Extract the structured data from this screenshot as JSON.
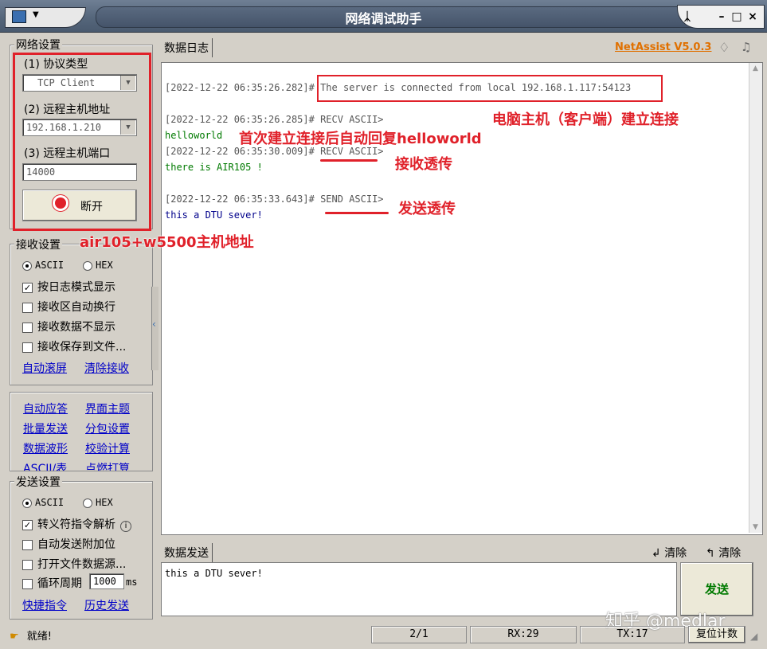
{
  "window": {
    "title": "网络调试助手",
    "menu_icon": "network-icon",
    "pin_label": "ᛣ",
    "min_label": "–",
    "max_label": "□",
    "close_label": "×"
  },
  "network": {
    "group_label": "网络设置",
    "protocol_label": "(1) 协议类型",
    "protocol_value": "TCP Client",
    "host_label": "(2) 远程主机地址",
    "host_value": "192.168.1.210",
    "port_label": "(3) 远程主机端口",
    "port_value": "14000",
    "disconnect_label": "断开"
  },
  "receive": {
    "group_label": "接收设置",
    "ascii_label": "ASCII",
    "hex_label": "HEX",
    "options": [
      {
        "label": "按日志模式显示",
        "checked": true
      },
      {
        "label": "接收区自动换行",
        "checked": false
      },
      {
        "label": "接收数据不显示",
        "checked": false
      },
      {
        "label": "接收保存到文件...",
        "checked": false
      }
    ],
    "link_autoscroll": "自动滚屏",
    "link_clear": "清除接收"
  },
  "tools": {
    "links": [
      "自动应答",
      "界面主题",
      "批量发送",
      "分包设置",
      "数据波形",
      "校验计算",
      "ASCII/表",
      "点燃打算"
    ]
  },
  "send": {
    "group_label": "发送设置",
    "ascii_label": "ASCII",
    "hex_label": "HEX",
    "options": [
      {
        "label": "转义符指令解析",
        "checked": true
      },
      {
        "label": "自动发送附加位",
        "checked": false
      },
      {
        "label": "打开文件数据源...",
        "checked": false
      },
      {
        "label": "循环周期",
        "checked": false
      }
    ],
    "period_value": "1000",
    "period_unit": "ms",
    "link_shortcut": "快捷指令",
    "link_history": "历史发送"
  },
  "log": {
    "tab_label": "数据日志",
    "version": "NetAssist V5.0.3",
    "lines": [
      {
        "text": "[2022-12-22 06:35:26.282]# The server is connected from local 192.168.1.117:54123",
        "color": "gray"
      },
      {
        "text": "[2022-12-22 06:35:26.285]# RECV ASCII>",
        "color": "gray"
      },
      {
        "text": "helloworld",
        "color": "green"
      },
      {
        "text": "[2022-12-22 06:35:30.009]# RECV ASCII>",
        "color": "gray"
      },
      {
        "text": "there is AIR105 !",
        "color": "green"
      },
      {
        "text": "[2022-12-22 06:35:33.643]# SEND ASCII>",
        "color": "gray"
      },
      {
        "text": "this a DTU sever!",
        "color": "blue"
      }
    ]
  },
  "annotations": {
    "host_connect": "电脑主机（客户端）建立连接",
    "auto_reply": "首次建立连接后自动回复helloworld",
    "recv_passthrough": "接收透传",
    "send_passthrough": "发送透传",
    "host_address": "air105+w5500主机地址"
  },
  "send_area": {
    "tab_label": "数据发送",
    "clear1": "清除",
    "clear2": "清除",
    "text": "this a DTU sever!",
    "send_button": "发送"
  },
  "status": {
    "ready": "就绪!",
    "page": "2/1",
    "rx": "RX:29",
    "tx": "TX:17",
    "reset_count": "复位计数"
  },
  "watermark": "知乎 @medlar",
  "colors": {
    "annotation": "#e0212a",
    "link": "#0000c8",
    "version": "#e07000"
  }
}
